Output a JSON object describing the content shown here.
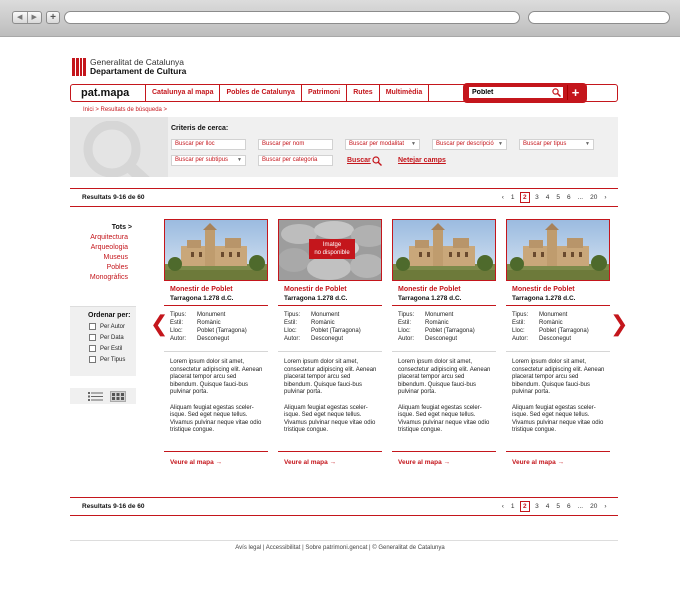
{
  "browser": {
    "back": "◀",
    "forward": "▶",
    "new_tab": "+"
  },
  "header": {
    "org_line1": "Generalitat de Catalunya",
    "org_line2": "Departament de Cultura",
    "brand": "pat.mapa",
    "menu": [
      "Catalunya al mapa",
      "Pobles de Catalunya",
      "Patrimoni",
      "Rutes",
      "Multimèdia"
    ],
    "search_value": "Poblet",
    "plus": "+"
  },
  "breadcrumb": "Inici > Resultats de búsqueda >",
  "criteria": {
    "title": "Criteris de cerca:",
    "fields": [
      "Buscar per lloc",
      "Buscar per nom",
      "Buscar per modalitat",
      "Buscar per descripció",
      "Buscar per tipus",
      "Buscar per subtipus",
      "Buscar per categoria"
    ],
    "search_label": "Buscar",
    "clear_label": "Netejar camps"
  },
  "results": {
    "label": "Resultats 9-16 de 60",
    "pager": [
      "‹",
      "1",
      "2",
      "3",
      "4",
      "5",
      "6",
      "...",
      "20",
      "›"
    ],
    "current_page": "2"
  },
  "sidebar": {
    "all": "Tots  >",
    "categories": [
      "Arquitectura",
      "Arqueologia",
      "Museus",
      "Pobles",
      "Monogràfics"
    ],
    "order_title": "Ordenar per:",
    "order_options": [
      "Per Autor",
      "Per Data",
      "Per Estil",
      "Per Tipus"
    ]
  },
  "nav": {
    "prev": "❮",
    "next": "❯"
  },
  "cards": [
    {
      "title": "Monestir de Poblet",
      "sub": "Tarragona 1.278 d.C.",
      "has_image": true,
      "meta": [
        [
          "Tipus:",
          "Monument"
        ],
        [
          "Estil:",
          "Romànic"
        ],
        [
          "Lloc:",
          "Poblet (Tarragona)"
        ],
        [
          "Autor:",
          "Desconegut"
        ]
      ],
      "p1": "Lorem ipsum dolor sit amet, consectetur adipiscing elit. Aenean placerat tempor arcu sed bibendum. Quisque fauci-bus pulvinar porta.",
      "p2": "Aliquam feugiat egestas sceler-isque. Sed eget neque tellus. Vivamus pulvinar neque vitae odio tristique congue.",
      "link": "Veure al mapa  →"
    },
    {
      "title": "Monestir de Poblet",
      "sub": "Tarragona 1.278 d.C.",
      "has_image": false,
      "noimg_l1": "Imatge",
      "noimg_l2": "no disponible",
      "meta": [
        [
          "Tipus:",
          "Monument"
        ],
        [
          "Estil:",
          "Romànic"
        ],
        [
          "Lloc:",
          "Poblet (Tarragona)"
        ],
        [
          "Autor:",
          "Desconegut"
        ]
      ],
      "p1": "Lorem ipsum dolor sit amet, consectetur adipiscing elit. Aenean placerat tempor arcu sed bibendum. Quisque fauci-bus pulvinar porta.",
      "p2": "Aliquam feugiat egestas sceler-isque. Sed eget neque tellus. Vivamus pulvinar neque vitae odio tristique congue.",
      "link": "Veure al mapa  →"
    },
    {
      "title": "Monestir de Poblet",
      "sub": "Tarragona 1.278 d.C.",
      "has_image": true,
      "meta": [
        [
          "Tipus:",
          "Monument"
        ],
        [
          "Estil:",
          "Romànic"
        ],
        [
          "Lloc:",
          "Poblet (Tarragona)"
        ],
        [
          "Autor:",
          "Desconegut"
        ]
      ],
      "p1": "Lorem ipsum dolor sit amet, consectetur adipiscing elit. Aenean placerat tempor arcu sed bibendum. Quisque fauci-bus pulvinar porta.",
      "p2": "Aliquam feugiat egestas sceler-isque. Sed eget neque tellus. Vivamus pulvinar neque vitae odio tristique congue.",
      "link": "Veure al mapa  →"
    },
    {
      "title": "Monestir de Poblet",
      "sub": "Tarragona 1.278 d.C.",
      "has_image": true,
      "meta": [
        [
          "Tipus:",
          "Monument"
        ],
        [
          "Estil:",
          "Romànic"
        ],
        [
          "Lloc:",
          "Poblet (Tarragona)"
        ],
        [
          "Autor:",
          "Desconegut"
        ]
      ],
      "p1": "Lorem ipsum dolor sit amet, consectetur adipiscing elit. Aenean placerat tempor arcu sed bibendum. Quisque fauci-bus pulvinar porta.",
      "p2": "Aliquam feugiat egestas sceler-isque. Sed eget neque tellus. Vivamus pulvinar neque vitae odio tristique congue.",
      "link": "Veure al mapa  →"
    }
  ],
  "footer": "Avís legal  |  Accessibilitat  |  Sobre patrimoni.gencat  |  © Generalitat de Catalunya",
  "colors": {
    "accent": "#c4161c"
  }
}
